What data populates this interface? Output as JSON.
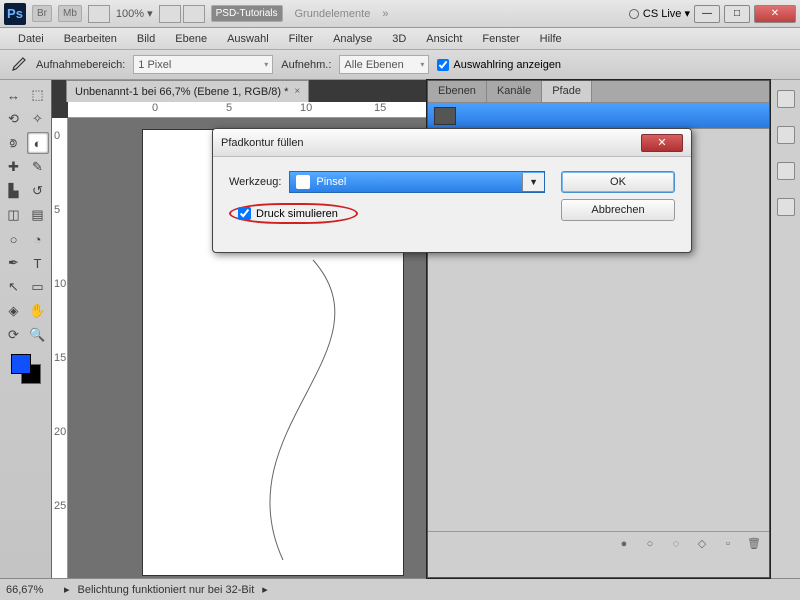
{
  "titlebar": {
    "logo": "Ps",
    "chips": [
      "Br",
      "Mb"
    ],
    "zoom": "100% ▾",
    "active_workspace": "PSD-Tutorials",
    "workspace2": "Grundelemente",
    "cslive": "CS Live ▾"
  },
  "menu": [
    "Datei",
    "Bearbeiten",
    "Bild",
    "Ebene",
    "Auswahl",
    "Filter",
    "Analyse",
    "3D",
    "Ansicht",
    "Fenster",
    "Hilfe"
  ],
  "options": {
    "label1": "Aufnahmebereich:",
    "value1": "1 Pixel",
    "label2": "Aufnehm.:",
    "value2": "Alle Ebenen",
    "checkbox": "Auswahlring anzeigen"
  },
  "doc_tab": "Unbenannt-1 bei 66,7% (Ebene 1, RGB/8) *",
  "ruler_marks_h": [
    "0",
    "5",
    "10",
    "15"
  ],
  "ruler_marks_v": [
    "0",
    "5",
    "10",
    "15",
    "20",
    "25"
  ],
  "panel": {
    "tabs": [
      "Ebenen",
      "Kanäle",
      "Pfade"
    ],
    "active_tab": "Pfade"
  },
  "dialog": {
    "title": "Pfadkontur füllen",
    "tool_label": "Werkzeug:",
    "tool_value": "Pinsel",
    "simulate": "Druck simulieren",
    "ok": "OK",
    "cancel": "Abbrechen"
  },
  "status": {
    "zoom": "66,67%",
    "msg": "Belichtung funktioniert nur bei 32-Bit"
  },
  "colors": {
    "foreground": "#1050ff",
    "background": "#000000"
  }
}
